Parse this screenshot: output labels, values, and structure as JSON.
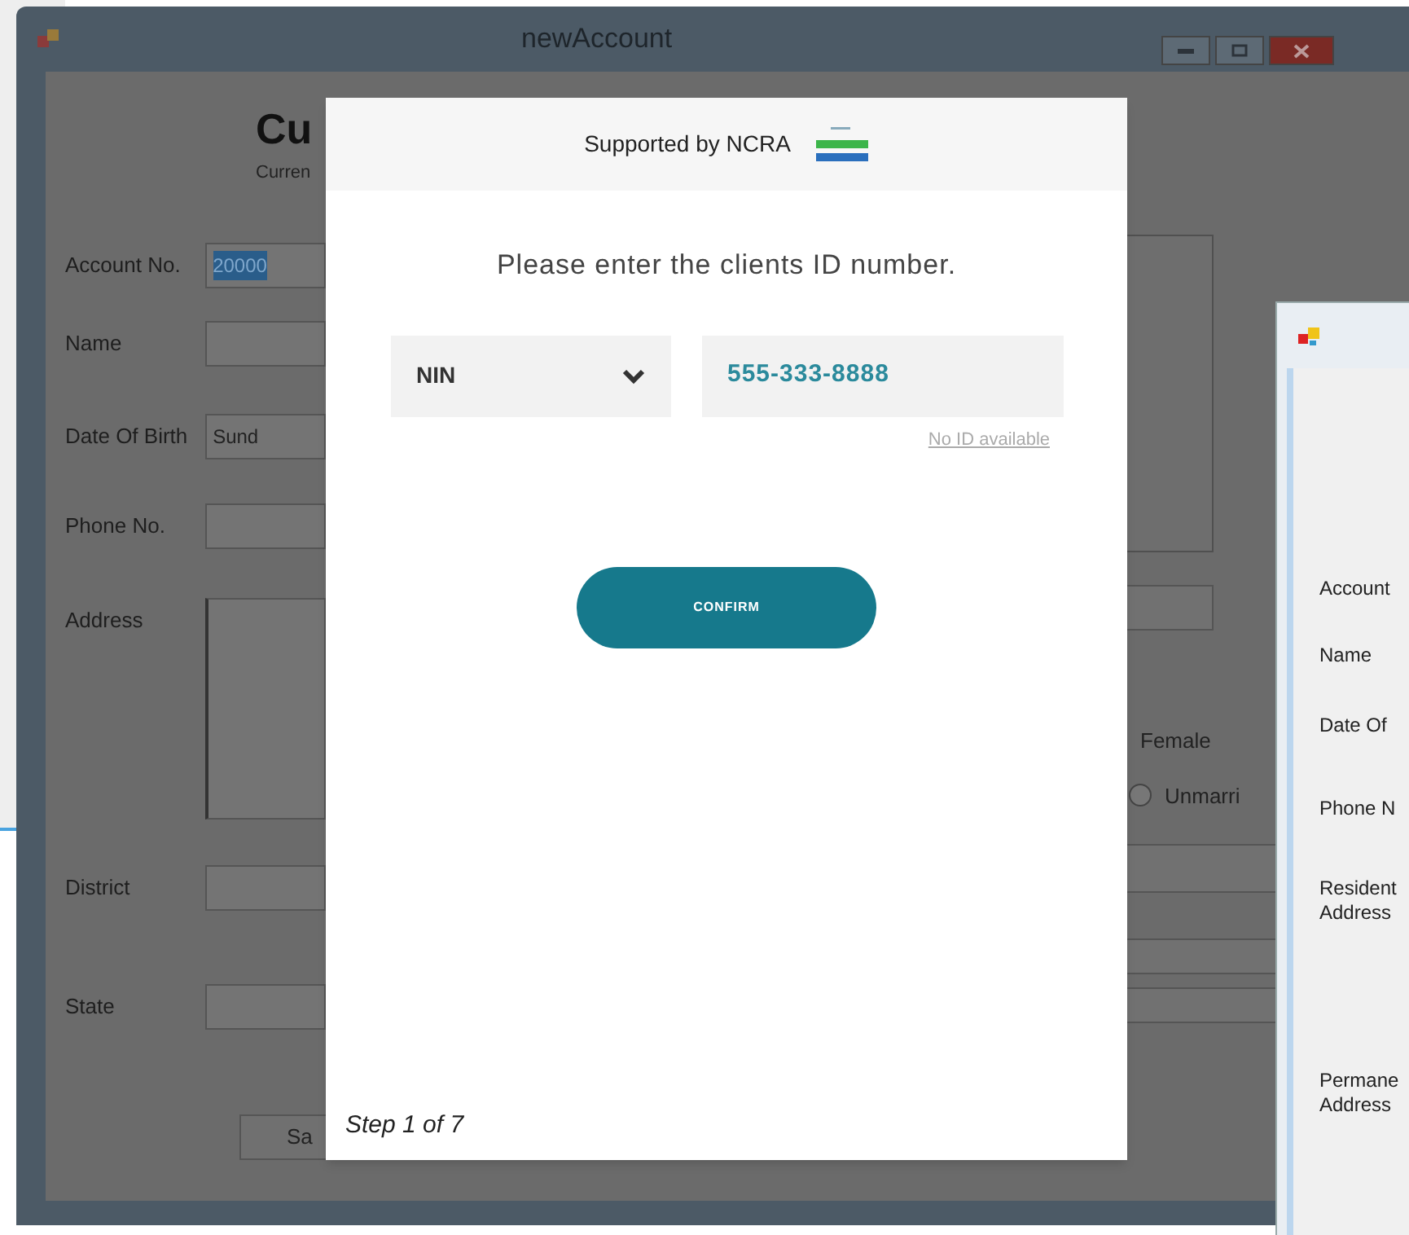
{
  "main_window": {
    "title": "newAccount",
    "heading": "Cu",
    "subheading": "Curren",
    "fields": [
      {
        "label": "Account No.",
        "kind": "text",
        "value": "20000",
        "selected": true
      },
      {
        "label": "Name",
        "kind": "text"
      },
      {
        "label": "Date Of Birth",
        "kind": "text",
        "value": "Sund",
        "selected": false
      },
      {
        "label": "Phone No.",
        "kind": "text"
      },
      {
        "label": "Address",
        "kind": "multiline"
      },
      {
        "label": "District",
        "kind": "text"
      },
      {
        "label": "State",
        "kind": "text"
      }
    ],
    "save_button": "Sa",
    "radios": [
      {
        "label": "Female",
        "kind": "hidden_circle"
      },
      {
        "label": "Unmarri",
        "kind": "radio",
        "selected": false
      }
    ]
  },
  "dialog": {
    "header": "Supported by NCRA",
    "prompt": "Please enter the clients ID number.",
    "id_type": "NIN",
    "id_value": "555-333-8888",
    "no_id_link": "No ID available",
    "confirm_button": "CONFIRM",
    "step": "Step 1 of 7"
  },
  "second_window": {
    "labels": [
      {
        "lines": [
          "Account"
        ]
      },
      {
        "lines": [
          "Name"
        ]
      },
      {
        "lines": [
          "Date Of"
        ]
      },
      {
        "lines": [
          "Phone N"
        ]
      },
      {
        "lines": [
          "Resident",
          "Address"
        ]
      },
      {
        "lines": [
          "Permane",
          "Address"
        ]
      }
    ]
  }
}
